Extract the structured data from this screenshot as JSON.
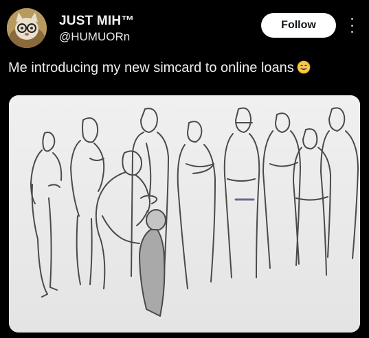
{
  "user": {
    "display_name": "JUST MIH™",
    "handle": "@HUMUORn",
    "avatar_icon": "cat-with-glasses-avatar"
  },
  "follow_label": "Follow",
  "more_icon": "vertical-ellipsis-icon",
  "tweet": {
    "text": "Me introducing my new simcard to online loans",
    "emoji": "grinning-sweat-emoji"
  },
  "media": {
    "description_icon": "sketch-illustration",
    "background": "#eeeeee",
    "stroke": "#4a4a4a"
  },
  "colors": {
    "background": "#000000",
    "text": "#e7e9ea",
    "button_bg": "#ffffff",
    "button_text": "#0f1419"
  }
}
